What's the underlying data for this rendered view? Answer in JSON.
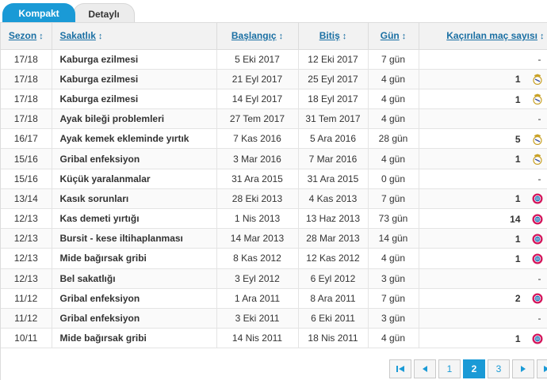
{
  "tabs": {
    "compact": "Kompakt",
    "detailed": "Detaylı"
  },
  "table": {
    "headers": {
      "season": "Sezon",
      "injury": "Sakatlık",
      "from": "Başlangıç",
      "until": "Bitiş",
      "days": "Gün",
      "missed": "Kaçırılan maç sayısı"
    },
    "sort_glyph": "↕",
    "rows": [
      {
        "season": "17/18",
        "injury": "Kaburga ezilmesi",
        "from": "5 Eki 2017",
        "until": "12 Eki 2017",
        "days": "7 gün",
        "missed": "-",
        "club": ""
      },
      {
        "season": "17/18",
        "injury": "Kaburga ezilmesi",
        "from": "21 Eyl 2017",
        "until": "25 Eyl 2017",
        "days": "4 gün",
        "missed": "1",
        "club": "real-madrid"
      },
      {
        "season": "17/18",
        "injury": "Kaburga ezilmesi",
        "from": "14 Eyl 2017",
        "until": "18 Eyl 2017",
        "days": "4 gün",
        "missed": "1",
        "club": "real-madrid"
      },
      {
        "season": "17/18",
        "injury": "Ayak bileği problemleri",
        "from": "27 Tem 2017",
        "until": "31 Tem 2017",
        "days": "4 gün",
        "missed": "-",
        "club": ""
      },
      {
        "season": "16/17",
        "injury": "Ayak kemek ekleminde yırtık",
        "from": "7 Kas 2016",
        "until": "5 Ara 2016",
        "days": "28 gün",
        "missed": "5",
        "club": "real-madrid"
      },
      {
        "season": "15/16",
        "injury": "Gribal enfeksiyon",
        "from": "3 Mar 2016",
        "until": "7 Mar 2016",
        "days": "4 gün",
        "missed": "1",
        "club": "real-madrid"
      },
      {
        "season": "15/16",
        "injury": "Küçük yaralanmalar",
        "from": "31 Ara 2015",
        "until": "31 Ara 2015",
        "days": "0 gün",
        "missed": "-",
        "club": ""
      },
      {
        "season": "13/14",
        "injury": "Kasık sorunları",
        "from": "28 Eki 2013",
        "until": "4 Kas 2013",
        "days": "7 gün",
        "missed": "1",
        "club": "bayern"
      },
      {
        "season": "12/13",
        "injury": "Kas demeti yırtığı",
        "from": "1 Nis 2013",
        "until": "13 Haz 2013",
        "days": "73 gün",
        "missed": "14",
        "club": "bayern"
      },
      {
        "season": "12/13",
        "injury": "Bursit - kese iltihaplanması",
        "from": "14 Mar 2013",
        "until": "28 Mar 2013",
        "days": "14 gün",
        "missed": "1",
        "club": "bayern"
      },
      {
        "season": "12/13",
        "injury": "Mide bağırsak gribi",
        "from": "8 Kas 2012",
        "until": "12 Kas 2012",
        "days": "4 gün",
        "missed": "1",
        "club": "bayern"
      },
      {
        "season": "12/13",
        "injury": "Bel sakatlığı",
        "from": "3 Eyl 2012",
        "until": "6 Eyl 2012",
        "days": "3 gün",
        "missed": "-",
        "club": ""
      },
      {
        "season": "11/12",
        "injury": "Gribal enfeksiyon",
        "from": "1 Ara 2011",
        "until": "8 Ara 2011",
        "days": "7 gün",
        "missed": "2",
        "club": "bayern"
      },
      {
        "season": "11/12",
        "injury": "Gribal enfeksiyon",
        "from": "3 Eki 2011",
        "until": "6 Eki 2011",
        "days": "3 gün",
        "missed": "-",
        "club": ""
      },
      {
        "season": "10/11",
        "injury": "Mide bağırsak gribi",
        "from": "14 Nis 2011",
        "until": "18 Nis 2011",
        "days": "4 gün",
        "missed": "1",
        "club": "bayern"
      }
    ]
  },
  "pagination": {
    "pages": [
      "1",
      "2",
      "3"
    ],
    "current": "2"
  },
  "colors": {
    "accent": "#1a9ad6",
    "header_link": "#1a6fa3",
    "real_madrid_gold": "#c9a227",
    "bayern_red": "#d4145a",
    "bayern_blue": "#1f6fb5"
  }
}
